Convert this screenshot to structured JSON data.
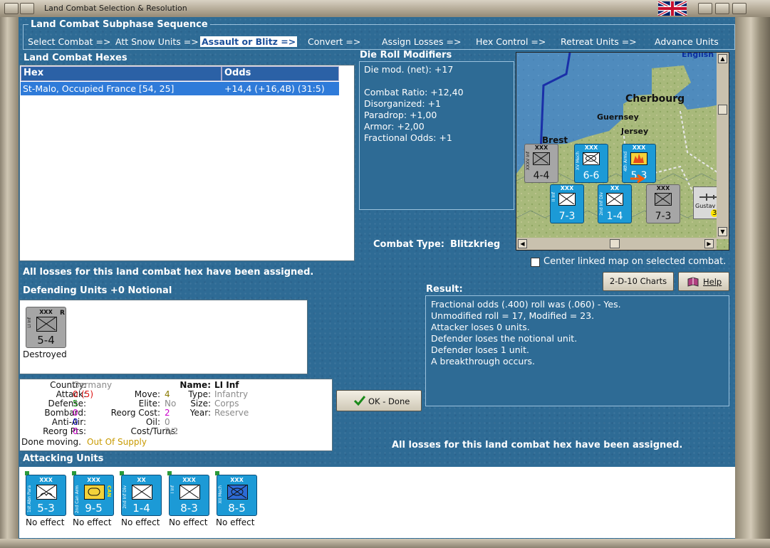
{
  "window": {
    "title": "Land Combat Selection & Resolution"
  },
  "sequence": {
    "title": "Land Combat Subphase Sequence",
    "steps": [
      "Select Combat =>",
      "Att Snow Units =>",
      "Assault or Blitz =>",
      "Convert =>",
      "Assign Losses =>",
      "Hex Control =>",
      "Retreat Units =>",
      "Advance Units"
    ],
    "selected_index": 2
  },
  "hexes": {
    "title": "Land Combat Hexes",
    "columns": [
      "Hex",
      "Odds"
    ],
    "rows": [
      {
        "hex": "St-Malo, Occupied France [54, 25]",
        "odds": "+14,4 (+16,4B) (31:5)"
      }
    ]
  },
  "modifiers": {
    "title": "Die Roll Modifiers",
    "lines": [
      "Die mod. (net): +17",
      "",
      "Combat Ratio: +12,40",
      "Disorganized: +1",
      "Paradrop: +1,00",
      "Armor: +2,00",
      "Fractional Odds: +1"
    ]
  },
  "combat_type": {
    "label": "Combat Type:",
    "value": "Blitzkrieg"
  },
  "map": {
    "labels": [
      "English",
      "Cherbourg",
      "Guernsey",
      "Jersey",
      "Brest",
      "Gustav"
    ],
    "center_checkbox_label": "Center linked map on selected combat.",
    "center_checked": false
  },
  "losses_msg": "All losses for this land combat hex have been assigned.",
  "defending": {
    "title": "Defending Units +0 Notional",
    "units": [
      {
        "name": "LI Inf",
        "size": "XXX",
        "corner": "R",
        "value": "5-4",
        "status": "Destroyed"
      }
    ]
  },
  "unit_info": {
    "country_label": "Country:",
    "country": "Germany",
    "attack_label": "Attack:",
    "attack": "0",
    "attack_paren": "(5)",
    "defense_label": "Defense:",
    "defense": "5",
    "bombard_label": "Bombard:",
    "bombard": "0",
    "antiair_label": "Anti-Air:",
    "antiair": "0",
    "reorg_pts_label": "Reorg Pts:",
    "reorg_pts": "0",
    "move_label": "Move:",
    "move": "4",
    "elite_label": "Elite:",
    "elite": "No",
    "reorg_cost_label": "Reorg Cost:",
    "reorg_cost": "2",
    "oil_label": "Oil:",
    "oil": "0",
    "cost_turns_label": "Cost/Turns:",
    "cost_turns": "3/2",
    "name_label": "Name:",
    "name": "LI Inf",
    "type_label": "Type:",
    "type": "Infantry",
    "size_label": "Size:",
    "size": "Corps",
    "year_label": "Year:",
    "year": "Reserve",
    "done_moving": "Done moving.",
    "supply": "Out Of Supply"
  },
  "buttons": {
    "charts": "2-D-10 Charts",
    "help": "Help",
    "ok": "OK - Done"
  },
  "result": {
    "title": "Result:",
    "lines": [
      "Fractional odds (.400) roll was (.060)  - Yes.",
      "Unmodified roll = 17, Modified = 23.",
      "Attacker loses 0 units.",
      "Defender loses the notional unit.",
      "Defender loses 1 unit.",
      "A breakthrough occurs."
    ]
  },
  "attacking": {
    "title": "Attacking Units",
    "units": [
      {
        "name": "1st Abn Para",
        "size": "XXX",
        "value": "5-3",
        "status": "No effect",
        "kind": "para"
      },
      {
        "name": "2nd Can Arm",
        "size": "XXX",
        "value": "9-5",
        "status": "No effect",
        "kind": "armor",
        "tag": "CAN"
      },
      {
        "name": "2nd Inf Div",
        "size": "XX",
        "value": "1-4",
        "status": "No effect",
        "kind": "inf"
      },
      {
        "name": "I Inf",
        "size": "XXX",
        "value": "8-3",
        "status": "No effect",
        "kind": "inf"
      },
      {
        "name": "XII Mech",
        "size": "XXX",
        "value": "8-5",
        "status": "No effect",
        "kind": "mech"
      }
    ]
  },
  "map_counters": [
    {
      "name": "XXXV Inf",
      "value": "4-4",
      "color": "gray"
    },
    {
      "name": "XV Mech",
      "value": "6-6",
      "color": "blue"
    },
    {
      "name": "4th Armd",
      "value": "5-3",
      "color": "blue"
    },
    {
      "name": "II Inf",
      "value": "7-3",
      "color": "blue"
    },
    {
      "name": "2nd Inf Div",
      "value": "1-4",
      "color": "blue"
    },
    {
      "name": "",
      "value": "7-3",
      "color": "gray"
    },
    {
      "name": "Gustav",
      "value": "3",
      "color": "none"
    }
  ],
  "colors": {
    "background": "#2e6b95",
    "header_blue": "#2b61a6",
    "selection": "#2f7bd9",
    "counter_blue": "#1c9ad6",
    "counter_gray": "#a6a6a6"
  }
}
